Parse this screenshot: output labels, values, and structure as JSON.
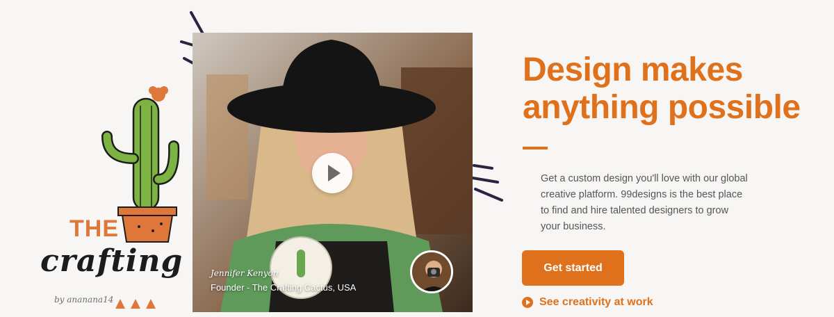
{
  "artwork": {
    "brand_the": "THE",
    "brand_name": "crafting cac",
    "credit": "by ananana14"
  },
  "video": {
    "person_name": "Jennifer Kenyon",
    "person_role": "Founder - The Crafting Cactus, USA",
    "play_icon": "play-icon"
  },
  "hero": {
    "headline": "Design makes anything possible",
    "description": "Get a custom design you'll love with our global creative platform. 99designs is the best place to find and hire talented designers to grow your business.",
    "cta_label": "Get started",
    "secondary_link": "See creativity at work"
  },
  "colors": {
    "accent": "#e0711c",
    "brand_orange": "#e0773a"
  }
}
